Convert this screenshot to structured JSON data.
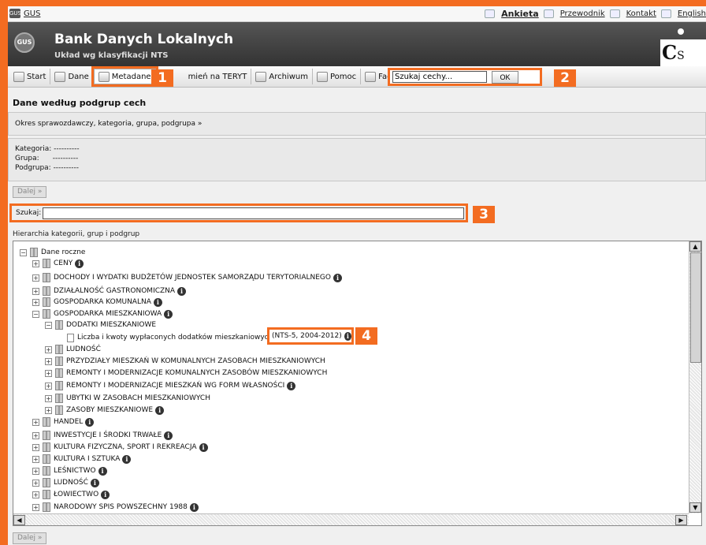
{
  "topbar": {
    "site": "GUS",
    "links": [
      "Ankieta",
      "Przewodnik",
      "Kontakt",
      "English"
    ]
  },
  "header": {
    "title": "Bank Danych Lokalnych",
    "subtitle": "Układ wg klasyfikacji NTS",
    "brand": "C",
    "brand_small": "S"
  },
  "toolbar": {
    "start": "Start",
    "dane": "Dane",
    "metadane": "Metadane",
    "teryt": "mień na TERYT",
    "archiwum": "Archiwum",
    "pomoc": "Pomoc",
    "facebook": "Facebook",
    "search_value": "Szukaj cechy...",
    "ok": "OK"
  },
  "badges": [
    "1",
    "2",
    "3",
    "4"
  ],
  "main": {
    "section_title": "Dane według podgrup cech",
    "breadcrumb": "Okres sprawozdawczy, kategoria, grupa, podgrupa »",
    "kategoria": "Kategoria: ----------",
    "grupa": "Grupa:      ----------",
    "podgrupa": "Podgrupa: ----------",
    "dalej": "Dalej »",
    "search_label": "Szukaj:",
    "hier_label": "Hierarchia kategorii, grup i podgrup"
  },
  "tree": {
    "root": "Dane roczne",
    "items": [
      "CENY",
      "DOCHODY I WYDATKI BUDŻETÓW JEDNOSTEK SAMORZĄDU TERYTORIALNEGO",
      "DZIAŁALNOŚĆ GASTRONOMICZNA",
      "GOSPODARKA KOMUNALNA",
      "GOSPODARKA MIESZKANIOWA",
      "DODATKI MIESZKANIOWE",
      "Liczba i kwoty wypłaconych dodatków mieszkaniowych",
      "LUDNOŚĆ",
      "PRZYDZIAŁY MIESZKAŃ W KOMUNALNYCH ZASOBACH MIESZKANIOWYCH",
      "REMONTY I MODERNIZACJE KOMUNALNYCH ZASOBÓW MIESZKANIOWYCH",
      "REMONTY I MODERNIZACJE MIESZKAŃ WG FORM WŁASNOŚCI",
      "UBYTKI W ZASOBACH MIESZKANIOWYCH",
      "ZASOBY MIESZKANIOWE",
      "HANDEL",
      "INWESTYCJE I ŚRODKI TRWAŁE",
      "KULTURA FIZYCZNA, SPORT I REKREACJA",
      "KULTURA I SZTUKA",
      "LEŚNICTWO",
      "LUDNOŚĆ",
      "ŁOWIECTWO",
      "NARODOWY SPIS POWSZECHNY 1988"
    ],
    "nts_label": "(NTS-5, 2004-2012)"
  }
}
